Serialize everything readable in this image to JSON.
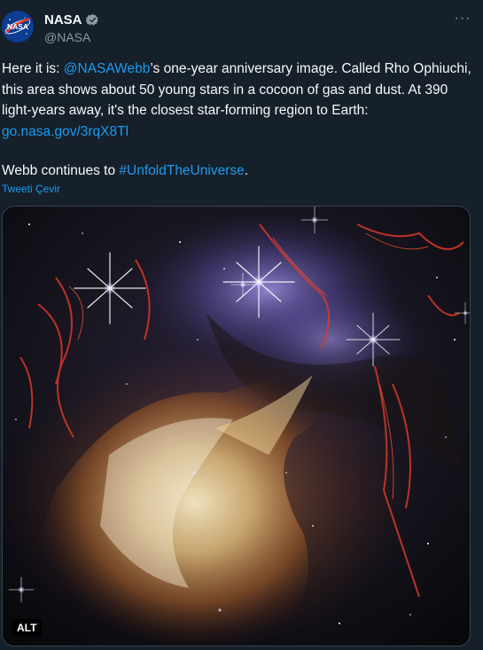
{
  "author": {
    "display_name": "NASA",
    "handle": "@NASA",
    "verified": true,
    "avatar_text": "NASA"
  },
  "tweet": {
    "para1_prefix": "Here it is: ",
    "mention": "@NASAWebb",
    "para1_text": "’s one-year anniversary image. Called Rho Ophiuchi, this area shows about 50 young stars in a cocoon of gas and dust. At 390 light-years away, it's the closest star-forming region to Earth: ",
    "url": "go.nasa.gov/3rqX8Tl",
    "para2_prefix": "Webb continues to ",
    "hashtag": "#UnfoldTheUniverse",
    "para2_suffix": "."
  },
  "translate_label": "Tweeti Çevir",
  "media": {
    "alt_label": "ALT"
  },
  "menu": {
    "more_label": "···"
  },
  "colors": {
    "background": "#15202b",
    "link": "#1d9bf0",
    "secondary_text": "#8b98a5",
    "verified": "#8b98a5"
  }
}
